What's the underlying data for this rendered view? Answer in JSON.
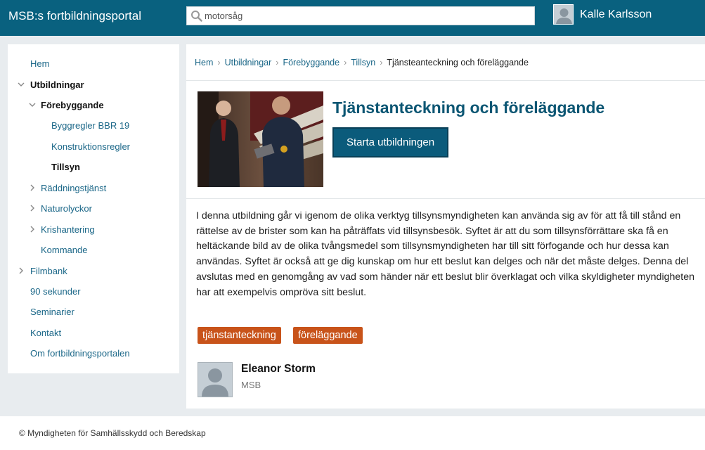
{
  "header": {
    "brand": "MSB:s fortbildningsportal",
    "search_value": "motorsåg",
    "user_name": "Kalle Karlsson"
  },
  "sidebar": {
    "items": [
      {
        "label": "Hem"
      },
      {
        "label": "Utbildningar",
        "expanded": true
      },
      {
        "label": "Förebyggande",
        "expanded": true
      },
      {
        "label": "Byggregler BBR 19"
      },
      {
        "label": "Konstruktionsregler"
      },
      {
        "label": "Tillsyn",
        "active": true
      },
      {
        "label": "Räddningstjänst"
      },
      {
        "label": "Naturolyckor"
      },
      {
        "label": "Krishantering"
      },
      {
        "label": "Kommande"
      },
      {
        "label": "Filmbank"
      },
      {
        "label": "90 sekunder"
      },
      {
        "label": "Seminarier"
      },
      {
        "label": "Kontakt"
      },
      {
        "label": "Om fortbildningsportalen"
      }
    ]
  },
  "breadcrumb": [
    "Hem",
    "Utbildningar",
    "Förebyggande",
    "Tillsyn",
    "Tjänsteanteckning och föreläggande"
  ],
  "course": {
    "title": "Tjänstanteckning och föreläggande",
    "start_button": "Starta utbildningen",
    "description": "I denna utbildning går vi igenom de olika verktyg tillsynsmyndigheten kan använda sig av för att få till stånd en rättelse av de brister som kan ha påträffats vid tillsynsbesök. Syftet är att du som tillsynsförrättare ska få en heltäckande bild av de olika tvångsmedel som tillsynsmyndigheten har till sitt förfogande och hur dessa kan användas. Syftet är också att ge dig kunskap om hur ett beslut kan delges och när det måste delges. Denna del avslutas med en genomgång av vad som händer när ett beslut blir överklagat och vilka skyldigheter myndigheten har att exempelvis ompröva sitt beslut.",
    "tags": [
      "tjänstanteckning",
      "föreläggande"
    ]
  },
  "author": {
    "name": "Eleanor Storm",
    "org": "MSB"
  },
  "footer": {
    "text": "© Myndigheten för Samhällsskydd och Beredskap"
  },
  "colors": {
    "header_bg": "#09617f",
    "link": "#1b6788",
    "title": "#0c5673",
    "tag_bg": "#c8531a",
    "page_bg": "#e8ecef"
  }
}
